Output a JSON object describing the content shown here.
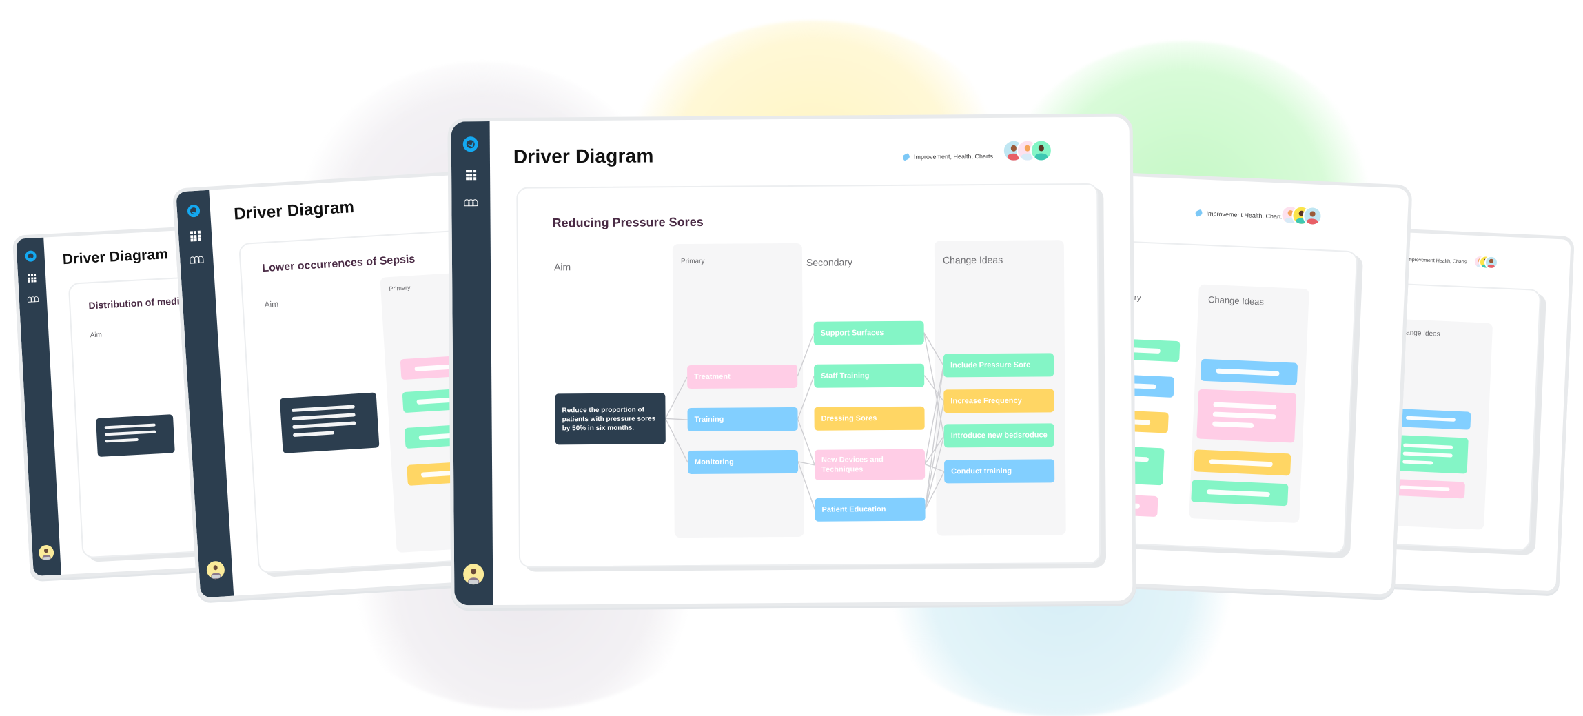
{
  "app": {
    "title": "Driver Diagram",
    "tags": "Improvement, Health, Charts",
    "nav": [
      {
        "icon": "refresh-logo-icon",
        "label": "Home"
      },
      {
        "icon": "grid-icon",
        "label": "Apps"
      },
      {
        "icon": "team-icon",
        "label": "Team"
      }
    ]
  },
  "colors": {
    "sidebar": "#2c3e4f",
    "accent": "#14a8f0",
    "pink": "#ffcde6",
    "blue": "#82cfff",
    "green": "#84f5c6",
    "yellow": "#ffd664"
  },
  "main": {
    "card_title": "Reducing Pressure Sores",
    "columns": {
      "aim": "Aim",
      "primary": "Primary",
      "secondary": "Secondary",
      "change_ideas": "Change Ideas"
    },
    "aim": {
      "text": "Reduce the proportion of patients with pressure sores by 50% in six months."
    },
    "primary": [
      {
        "id": "p1",
        "text": "Treatment",
        "color": "pink"
      },
      {
        "id": "p2",
        "text": "Training",
        "color": "blue"
      },
      {
        "id": "p3",
        "text": "Monitoring",
        "color": "blue"
      }
    ],
    "secondary": [
      {
        "id": "s1",
        "text": "Support Surfaces",
        "color": "green"
      },
      {
        "id": "s2",
        "text": "Staff Training",
        "color": "green"
      },
      {
        "id": "s3",
        "text": "Dressing Sores",
        "color": "yellow"
      },
      {
        "id": "s4",
        "text": "New Devices and Techniques",
        "color": "pink"
      },
      {
        "id": "s5",
        "text": "Patient Education",
        "color": "blue"
      }
    ],
    "change_ideas": [
      {
        "id": "c1",
        "text": "Include Pressure Sore",
        "color": "green"
      },
      {
        "id": "c2",
        "text": "Increase Frequency",
        "color": "yellow"
      },
      {
        "id": "c3",
        "text": "Introduce new bedsroduce",
        "color": "green"
      },
      {
        "id": "c4",
        "text": "Conduct training",
        "color": "blue"
      }
    ],
    "links": [
      [
        "aim",
        "p1"
      ],
      [
        "aim",
        "p2"
      ],
      [
        "aim",
        "p3"
      ],
      [
        "p1",
        "s1"
      ],
      [
        "p2",
        "s2"
      ],
      [
        "p2",
        "s4"
      ],
      [
        "p3",
        "s4"
      ],
      [
        "p3",
        "s5"
      ],
      [
        "s1",
        "c1"
      ],
      [
        "s1",
        "c3"
      ],
      [
        "s2",
        "c2"
      ],
      [
        "s4",
        "c1"
      ],
      [
        "s4",
        "c3"
      ],
      [
        "s4",
        "c4"
      ],
      [
        "s5",
        "c1"
      ],
      [
        "s5",
        "c2"
      ],
      [
        "s5",
        "c3"
      ],
      [
        "s5",
        "c4"
      ]
    ]
  },
  "left_panels": [
    {
      "title": "Driver Diagram",
      "card_title": "Distribution of medici",
      "aim_label": "Aim"
    },
    {
      "title": "Driver Diagram",
      "card_title": "Lower occurrences of Sepsis",
      "aim_label": "Aim",
      "primary_label": "Primary"
    }
  ],
  "right_panels": [
    {
      "tags": "Improvement Health, Charts",
      "secondary_label": "condary",
      "change_ideas_label": "Change Ideas"
    },
    {
      "tags": "Improvement Health, Charts",
      "change_ideas_label": "Change Ideas"
    }
  ]
}
